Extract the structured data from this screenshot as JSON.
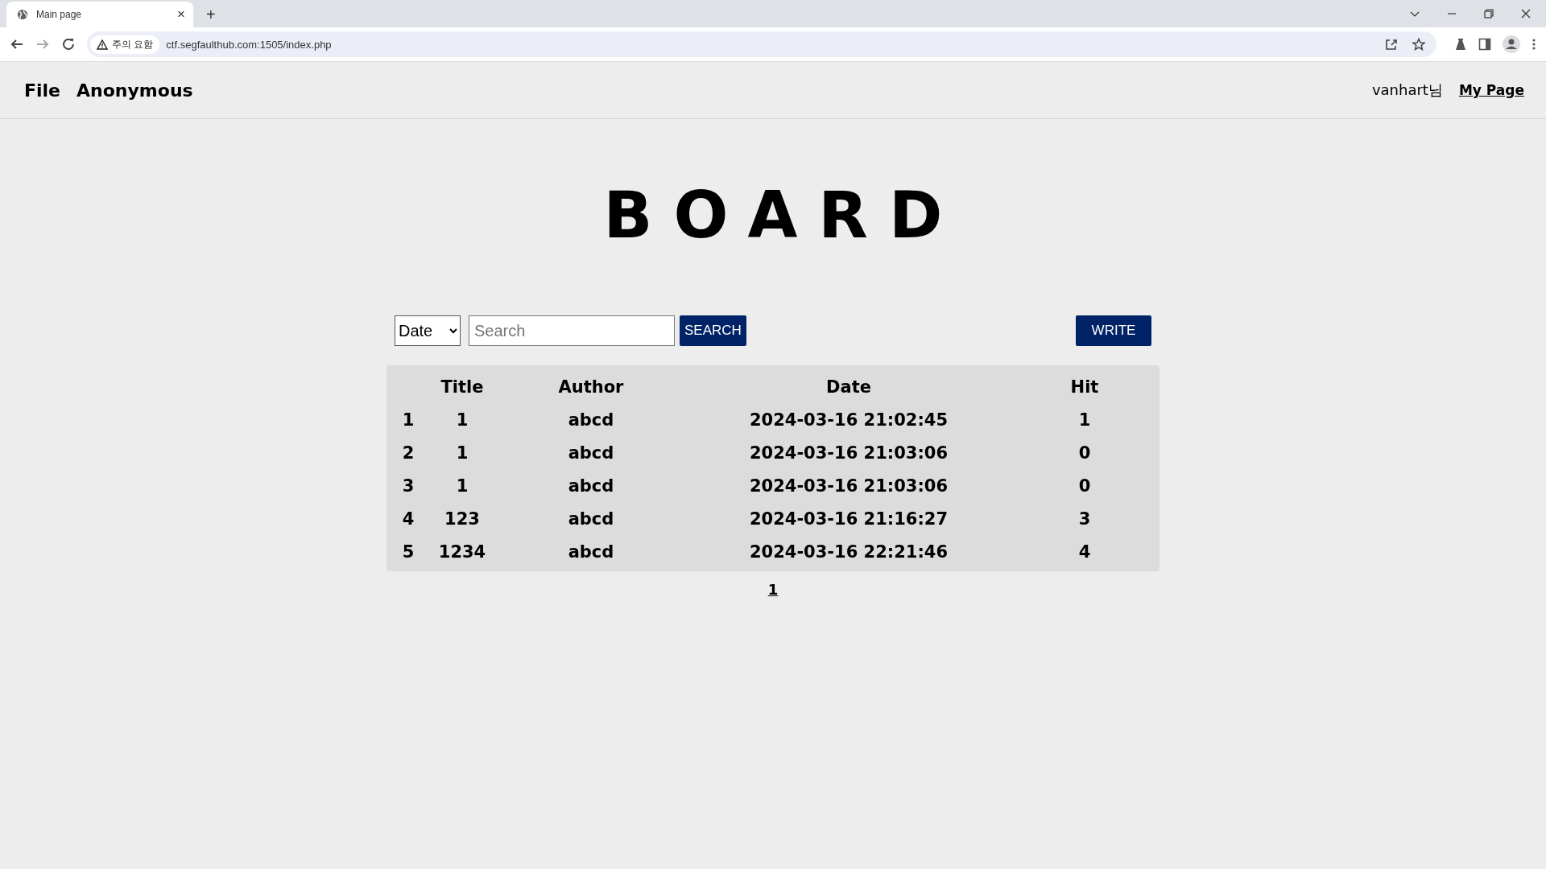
{
  "browser": {
    "tab": {
      "title": "Main page",
      "close": "×"
    },
    "new_tab": "+",
    "security_label": "주의 요함",
    "url": "ctf.segfaulthub.com:1505/index.php"
  },
  "nav": {
    "links": [
      "File",
      "Anonymous"
    ],
    "user": "vanhart님",
    "my_page": "My Page"
  },
  "heading": "BOARD",
  "search": {
    "filter": "Date",
    "placeholder": "Search",
    "button": "SEARCH"
  },
  "write_button": "WRITE",
  "table": {
    "columns": [
      "",
      "Title",
      "Author",
      "Date",
      "Hit"
    ],
    "rows": [
      [
        "1",
        "1",
        "abcd",
        "2024-03-16 21:02:45",
        "1"
      ],
      [
        "2",
        "1",
        "abcd",
        "2024-03-16 21:03:06",
        "0"
      ],
      [
        "3",
        "1",
        "abcd",
        "2024-03-16 21:03:06",
        "0"
      ],
      [
        "4",
        "123",
        "abcd",
        "2024-03-16 21:16:27",
        "3"
      ],
      [
        "5",
        "1234",
        "abcd",
        "2024-03-16 22:21:46",
        "4"
      ]
    ]
  },
  "pagination": [
    {
      "label": "1",
      "selected": true
    }
  ]
}
